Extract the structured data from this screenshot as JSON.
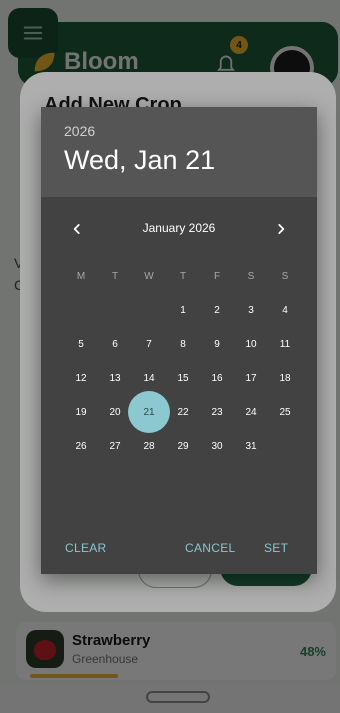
{
  "app": {
    "brand": "Bloom",
    "notification_count": "4",
    "side_letters": [
      "V",
      "C"
    ]
  },
  "crop_dialog": {
    "title": "Add New Crop"
  },
  "crop_item": {
    "name": "Strawberry",
    "location": "Greenhouse",
    "progress_percent": "48%",
    "progress_value": 0.48
  },
  "picker": {
    "year": "2026",
    "selected_label": "Wed, Jan 21",
    "month_label": "January 2026",
    "weekdays": [
      "M",
      "T",
      "W",
      "T",
      "F",
      "S",
      "S"
    ],
    "weeks": [
      [
        "",
        "",
        "",
        "1",
        "2",
        "3",
        "4"
      ],
      [
        "5",
        "6",
        "7",
        "8",
        "9",
        "10",
        "11"
      ],
      [
        "12",
        "13",
        "14",
        "15",
        "16",
        "17",
        "18"
      ],
      [
        "19",
        "20",
        "21",
        "22",
        "23",
        "24",
        "25"
      ],
      [
        "26",
        "27",
        "28",
        "29",
        "30",
        "31",
        ""
      ]
    ],
    "selected_day": "21",
    "actions": {
      "clear": "CLEAR",
      "cancel": "CANCEL",
      "set": "SET"
    }
  },
  "colors": {
    "accent": "#86c7d0",
    "selected_circle": "#8cc8cf",
    "picker_bg": "#424242",
    "header_bg": "#555555",
    "brand_green": "#1e5a3a"
  },
  "icons": {
    "menu": "menu-icon",
    "bell": "bell-icon",
    "prev": "chevron-left-icon",
    "next": "chevron-right-icon",
    "leaf": "leaf-icon"
  }
}
